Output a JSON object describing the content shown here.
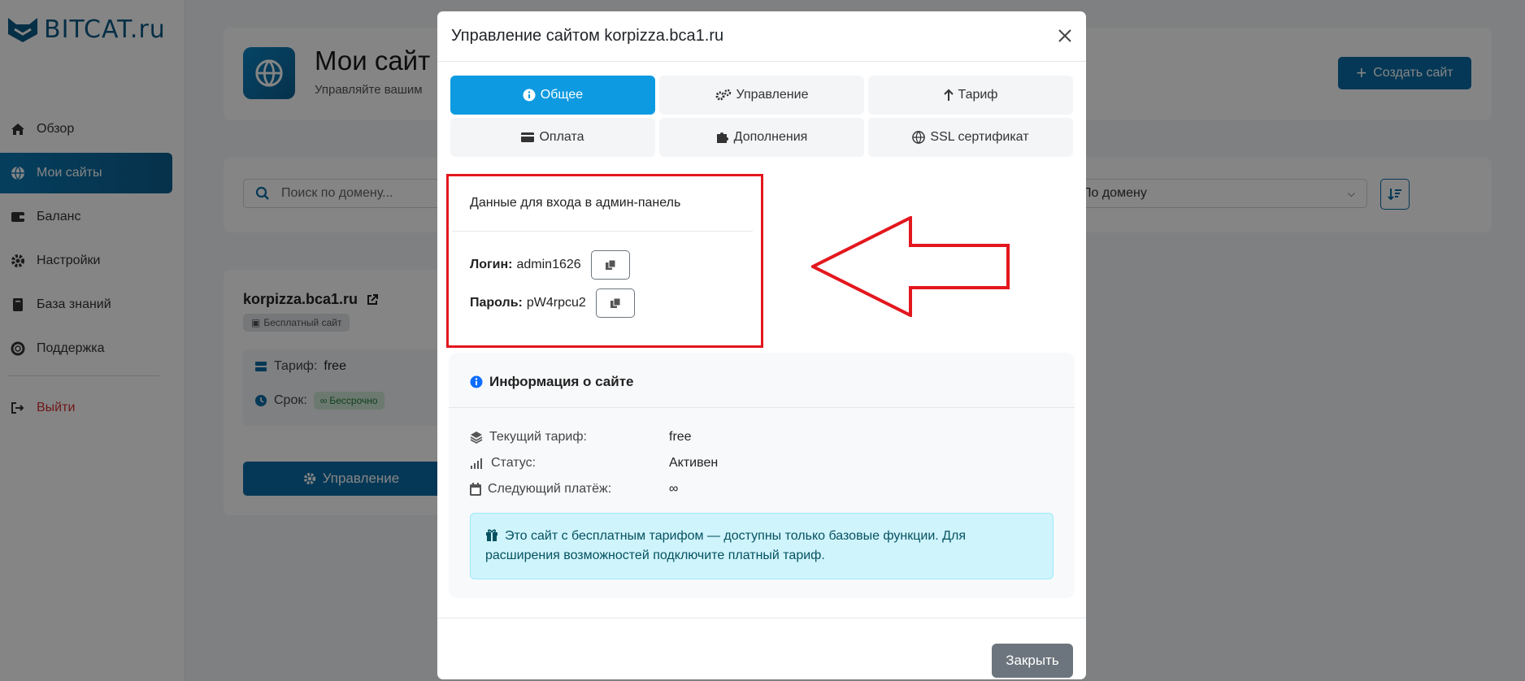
{
  "brand": {
    "name": "BITCAT.ru"
  },
  "sidebar": {
    "items": [
      {
        "label": "Обзор",
        "icon": "home-icon"
      },
      {
        "label": "Мои сайты",
        "icon": "globe-icon",
        "active": true
      },
      {
        "label": "Баланс",
        "icon": "wallet-icon"
      },
      {
        "label": "Настройки",
        "icon": "gear-icon"
      },
      {
        "label": "База знаний",
        "icon": "book-icon"
      },
      {
        "label": "Поддержка",
        "icon": "lifebuoy-icon"
      }
    ],
    "logout": {
      "label": "Выйти",
      "icon": "logout-icon"
    }
  },
  "page": {
    "title": "Мои сайт",
    "subtitle": "Управляйте вашим",
    "create_button": "Создать сайт",
    "search_placeholder": "Поиск по домену...",
    "sort_value": "По домену"
  },
  "site_card": {
    "domain": "korpizza.bca1.ru",
    "badge": "Бесплатный сайт",
    "tarif_label": "Тариф:",
    "tarif_value": "free",
    "term_label": "Срок:",
    "term_value": "Бессрочно",
    "manage_button": "Управление"
  },
  "modal": {
    "title": "Управление сайтом korpizza.bca1.ru",
    "tabs": [
      {
        "label": "Общее",
        "icon": "info-circle-icon",
        "active": true
      },
      {
        "label": "Управление",
        "icon": "gears-icon"
      },
      {
        "label": "Тариф",
        "icon": "arrow-up-icon"
      },
      {
        "label": "Оплата",
        "icon": "credit-card-icon"
      },
      {
        "label": "Дополнения",
        "icon": "puzzle-icon"
      },
      {
        "label": "SSL сертификат",
        "icon": "globe-icon"
      }
    ],
    "login": {
      "heading": "Данные для входа в админ-панель",
      "login_label": "Логин:",
      "login_value": "admin1626",
      "password_label": "Пароль:",
      "password_value": "pW4rpcu2"
    },
    "info": {
      "heading": "Информация о сайте",
      "rows": [
        {
          "key": "Текущий тариф:",
          "value": "free",
          "icon": "layers-icon"
        },
        {
          "key": "Статус:",
          "value": "Активен",
          "icon": "signal-icon"
        },
        {
          "key": "Следующий платёж:",
          "value": "∞",
          "icon": "calendar-icon"
        }
      ],
      "alert": "Это сайт с бесплатным тарифом — доступны только базовые функции. Для расширения возможностей подключите платный тариф."
    },
    "close_button": "Закрыть"
  },
  "colors": {
    "accent": "#0d9ae0",
    "primary": "#0b6ba5",
    "highlight": "#e3171e",
    "alert_bg": "#cff4fc"
  }
}
